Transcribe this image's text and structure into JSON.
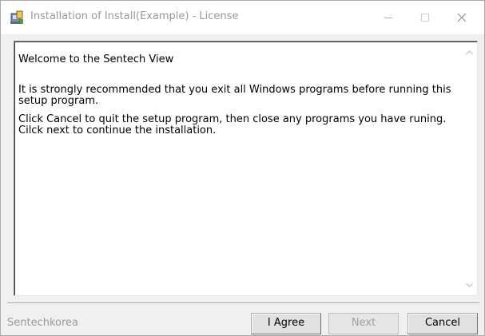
{
  "window": {
    "title": "Installation of Install(Example) - License",
    "controls": {
      "minimize": "—",
      "maximize": "□",
      "close": "✕"
    }
  },
  "license": {
    "welcome": "Welcome to the Sentech View",
    "recommendation": "It is strongly recommended that you exit all Windows programs before running this setup program.",
    "instructions": "Click Cancel to quit the setup program, then close any programs you have runing. Cilck next to continue the installation."
  },
  "footer": {
    "brand": "Sentechkorea",
    "agree_label": "I Agree",
    "next_label": "Next",
    "cancel_label": "Cancel"
  },
  "icons": {
    "app": "installer-icon",
    "scroll_up": "chevron-up-icon",
    "scroll_down": "chevron-down-icon"
  },
  "colors": {
    "title_text": "#999999",
    "disabled_text": "#a0a0a0",
    "background": "#f0f0f0"
  }
}
